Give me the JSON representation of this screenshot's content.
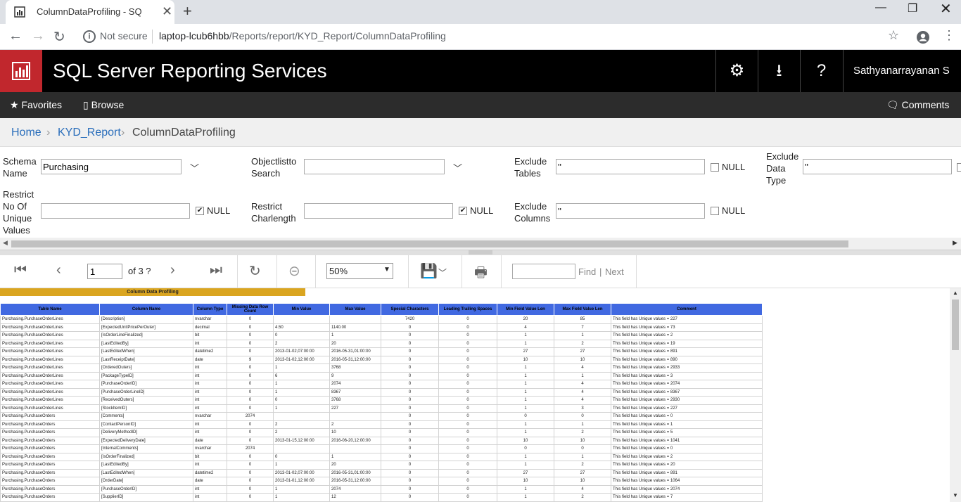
{
  "browser": {
    "tab_title": "ColumnDataProfiling - SQL Serve",
    "not_secure": "Not secure",
    "url_host": "laptop-lcub6hbb",
    "url_path": "/Reports/report/KYD_Report/ColumnDataProfiling"
  },
  "header": {
    "title": "SQL Server Reporting Services",
    "user": "Sathyanarrayanan S"
  },
  "nav": {
    "favorites": "Favorites",
    "browse": "Browse",
    "comments": "Comments"
  },
  "breadcrumb": {
    "home": "Home",
    "folder": "KYD_Report",
    "current": "ColumnDataProfiling"
  },
  "params": {
    "schema_label": "Schema Name",
    "schema_value": "Purchasing",
    "objectlist_label": "Objectlistto Search",
    "objectlist_value": "",
    "exclude_tables_label": "Exclude Tables",
    "exclude_tables_value": "''",
    "exclude_datatype_label": "Exclude Data Type",
    "exclude_datatype_value": "''",
    "restrict_unique_label": "Restrict No Of Unique Values",
    "restrict_unique_value": "",
    "restrict_charlen_label": "Restrict Charlength",
    "restrict_charlen_value": "",
    "exclude_columns_label": "Exclude Columns",
    "exclude_columns_value": "''",
    "null_label": "NULL"
  },
  "toolbar": {
    "page": "1",
    "of_pages": "of 3 ?",
    "zoom": "50%",
    "find": "Find",
    "sep": "|",
    "next": "Next"
  },
  "report": {
    "title": "Column Data Profiling",
    "columns": [
      "Table Name",
      "Column Name",
      "Column Type",
      "Missing Data Row Count",
      "Min Value",
      "Max Value",
      "Special Characters",
      "Leading Trailing Spaces",
      "Min Field Value Len",
      "Max Field Value Len",
      "Comment"
    ],
    "rows": [
      [
        "Purchasing.PurchaseOrderLines",
        "[Description]",
        "nvarchar",
        "0",
        "",
        "",
        "7420",
        "0",
        "20",
        "85",
        "This field has Unique values = 227"
      ],
      [
        "Purchasing.PurchaseOrderLines",
        "[ExpectedUnitPricePerOuter]",
        "decimal",
        "0",
        "4.50",
        "1140.00",
        "0",
        "0",
        "4",
        "7",
        "This field has Unique values = 73"
      ],
      [
        "Purchasing.PurchaseOrderLines",
        "[IsOrderLineFinalized]",
        "bit",
        "0",
        "0",
        "1",
        "0",
        "0",
        "1",
        "1",
        "This field has Unique values = 2"
      ],
      [
        "Purchasing.PurchaseOrderLines",
        "[LastEditedBy]",
        "int",
        "0",
        "2",
        "20",
        "0",
        "0",
        "1",
        "2",
        "This field has Unique values = 19"
      ],
      [
        "Purchasing.PurchaseOrderLines",
        "[LastEditedWhen]",
        "datetime2",
        "0",
        "2013-01-02,07:00:00",
        "2016-05-31,01:00:00",
        "0",
        "0",
        "27",
        "27",
        "This field has Unique values = 891"
      ],
      [
        "Purchasing.PurchaseOrderLines",
        "[LastReceiptDate]",
        "date",
        "9",
        "2013-01-02,12:00:00",
        "2016-05-31,12:00:00",
        "0",
        "0",
        "10",
        "10",
        "This field has Unique values = 890"
      ],
      [
        "Purchasing.PurchaseOrderLines",
        "[OrderedOuters]",
        "int",
        "0",
        "1",
        "3768",
        "0",
        "0",
        "1",
        "4",
        "This field has Unique values = 2933"
      ],
      [
        "Purchasing.PurchaseOrderLines",
        "[PackageTypeID]",
        "int",
        "0",
        "6",
        "9",
        "0",
        "0",
        "1",
        "1",
        "This field has Unique values = 3"
      ],
      [
        "Purchasing.PurchaseOrderLines",
        "[PurchaseOrderID]",
        "int",
        "0",
        "1",
        "2074",
        "0",
        "0",
        "1",
        "4",
        "This field has Unique values = 2074"
      ],
      [
        "Purchasing.PurchaseOrderLines",
        "[PurchaseOrderLineID]",
        "int",
        "0",
        "1",
        "8367",
        "0",
        "0",
        "1",
        "4",
        "This field has Unique values = 8367"
      ],
      [
        "Purchasing.PurchaseOrderLines",
        "[ReceivedOuters]",
        "int",
        "0",
        "0",
        "3768",
        "0",
        "0",
        "1",
        "4",
        "This field has Unique values = 2930"
      ],
      [
        "Purchasing.PurchaseOrderLines",
        "[StockItemID]",
        "int",
        "0",
        "1",
        "227",
        "0",
        "0",
        "1",
        "3",
        "This field has Unique values = 227"
      ],
      [
        "Purchasing.PurchaseOrders",
        "[Comments]",
        "nvarchar",
        "2074",
        "",
        "",
        "0",
        "0",
        "0",
        "0",
        "This field has Unique values = 0"
      ],
      [
        "Purchasing.PurchaseOrders",
        "[ContactPersonID]",
        "int",
        "0",
        "2",
        "2",
        "0",
        "0",
        "1",
        "1",
        "This field has Unique values = 1"
      ],
      [
        "Purchasing.PurchaseOrders",
        "[DeliveryMethodID]",
        "int",
        "0",
        "2",
        "10",
        "0",
        "0",
        "1",
        "2",
        "This field has Unique values = 5"
      ],
      [
        "Purchasing.PurchaseOrders",
        "[ExpectedDeliveryDate]",
        "date",
        "0",
        "2013-01-15,12:00:00",
        "2016-06-20,12:00:00",
        "0",
        "0",
        "10",
        "10",
        "This field has Unique values = 1041"
      ],
      [
        "Purchasing.PurchaseOrders",
        "[InternalComments]",
        "nvarchar",
        "2074",
        "",
        "",
        "0",
        "0",
        "0",
        "0",
        "This field has Unique values = 0"
      ],
      [
        "Purchasing.PurchaseOrders",
        "[IsOrderFinalized]",
        "bit",
        "0",
        "0",
        "1",
        "0",
        "0",
        "1",
        "1",
        "This field has Unique values = 2"
      ],
      [
        "Purchasing.PurchaseOrders",
        "[LastEditedBy]",
        "int",
        "0",
        "1",
        "20",
        "0",
        "0",
        "1",
        "2",
        "This field has Unique values = 20"
      ],
      [
        "Purchasing.PurchaseOrders",
        "[LastEditedWhen]",
        "datetime2",
        "0",
        "2013-01-02,07:00:00",
        "2016-05-31,01:00:00",
        "0",
        "0",
        "27",
        "27",
        "This field has Unique values = 891"
      ],
      [
        "Purchasing.PurchaseOrders",
        "[OrderDate]",
        "date",
        "0",
        "2013-01-01,12:00:00",
        "2016-05-31,12:00:00",
        "0",
        "0",
        "10",
        "10",
        "This field has Unique values = 1064"
      ],
      [
        "Purchasing.PurchaseOrders",
        "[PurchaseOrderID]",
        "int",
        "0",
        "1",
        "2074",
        "0",
        "0",
        "1",
        "4",
        "This field has Unique values = 2074"
      ],
      [
        "Purchasing.PurchaseOrders",
        "[SupplierID]",
        "int",
        "0",
        "1",
        "12",
        "0",
        "0",
        "1",
        "2",
        "This field has Unique values = 7"
      ]
    ]
  },
  "colors": {
    "brand_red": "#c1272d",
    "header_bg": "#000000",
    "nav_bg": "#2c2c2c",
    "report_title_bg": "#daa520",
    "table_header_bg": "#4169e1",
    "link": "#2a6ebb"
  }
}
